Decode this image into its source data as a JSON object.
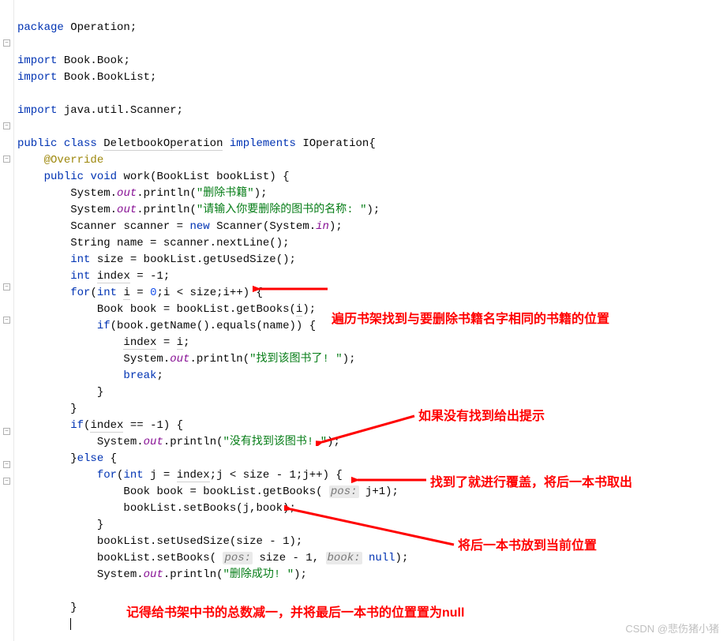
{
  "code": {
    "l1": {
      "kw": "package",
      "pkg": "Operation"
    },
    "l3": {
      "kw": "import",
      "path": "Book.Book"
    },
    "l4": {
      "kw": "import",
      "path": "Book.BookList"
    },
    "l6": {
      "kw": "import",
      "path": "java.util.Scanner"
    },
    "l8": {
      "kw1": "public",
      "kw2": "class",
      "name": "DeletbookOperation",
      "kw3": "implements",
      "iface": "IOperation"
    },
    "l9": {
      "ann": "@Override"
    },
    "l10": {
      "kw1": "public",
      "kw2": "void",
      "method": "work",
      "param_type": "BookList",
      "param_name": "bookList"
    },
    "l11": {
      "obj": "System",
      "field": "out",
      "call": "println",
      "str": "\"删除书籍\""
    },
    "l12": {
      "obj": "System",
      "field": "out",
      "call": "println",
      "str": "\"请输入你要删除的图书的名称: \""
    },
    "l13": {
      "type": "Scanner",
      "var": "scanner",
      "kw": "new",
      "ctor": "Scanner",
      "obj": "System",
      "field": "in"
    },
    "l14": {
      "type": "String",
      "var": "name",
      "rhs": "scanner.nextLine()"
    },
    "l15": {
      "kw": "int",
      "var": "size",
      "rhs": "bookList.getUsedSize()"
    },
    "l16": {
      "kw": "int",
      "var": "index",
      "val": "-1"
    },
    "l17": {
      "kw": "for",
      "kw2": "int",
      "var": "i",
      "init": "0",
      "cond": "i < size",
      "step": "i++"
    },
    "l18": {
      "type": "Book",
      "var": "book",
      "call": "bookList.getBooks",
      "arg": "i"
    },
    "l19": {
      "kw": "if",
      "cond": "book.getName().equals(name)"
    },
    "l20": {
      "lhs": "index",
      "rhs": "i"
    },
    "l21": {
      "obj": "System",
      "field": "out",
      "call": "println",
      "str": "\"找到该图书了! \""
    },
    "l22": {
      "kw": "break"
    },
    "l25": {
      "kw": "if",
      "lhs": "index",
      "val": "-1"
    },
    "l26": {
      "obj": "System",
      "field": "out",
      "call": "println",
      "str": "\"没有找到该图书! \""
    },
    "l27": {
      "kw": "else"
    },
    "l28": {
      "kw": "for",
      "kw2": "int",
      "var": "j",
      "init": "index",
      "cond": "j < size - 1",
      "step": "j++"
    },
    "l29": {
      "type": "Book",
      "var": "book",
      "call": "bookList.getBooks",
      "hint": "pos:",
      "arg": "j+1"
    },
    "l30": {
      "call": "bookList.setBooks",
      "args": "j,book"
    },
    "l32": {
      "call": "bookList.setUsedSize",
      "args": "size - 1"
    },
    "l33": {
      "call": "bookList.setBooks",
      "hint1": "pos:",
      "arg1": "size - 1",
      "hint2": "book:",
      "arg2": "null"
    },
    "l34": {
      "obj": "System",
      "field": "out",
      "call": "println",
      "str": "\"删除成功! \""
    }
  },
  "annotations": {
    "a1": "遍历书架找到与要删除书籍名字相同的书籍的位置",
    "a2": "如果没有找到给出提示",
    "a3": "找到了就进行覆盖，将后一本书取出",
    "a4": "将后一本书放到当前位置",
    "a5": "记得给书架中书的总数减一，并将最后一本书的位置置为null"
  },
  "watermark": "CSDN @悲伤猪小猪"
}
